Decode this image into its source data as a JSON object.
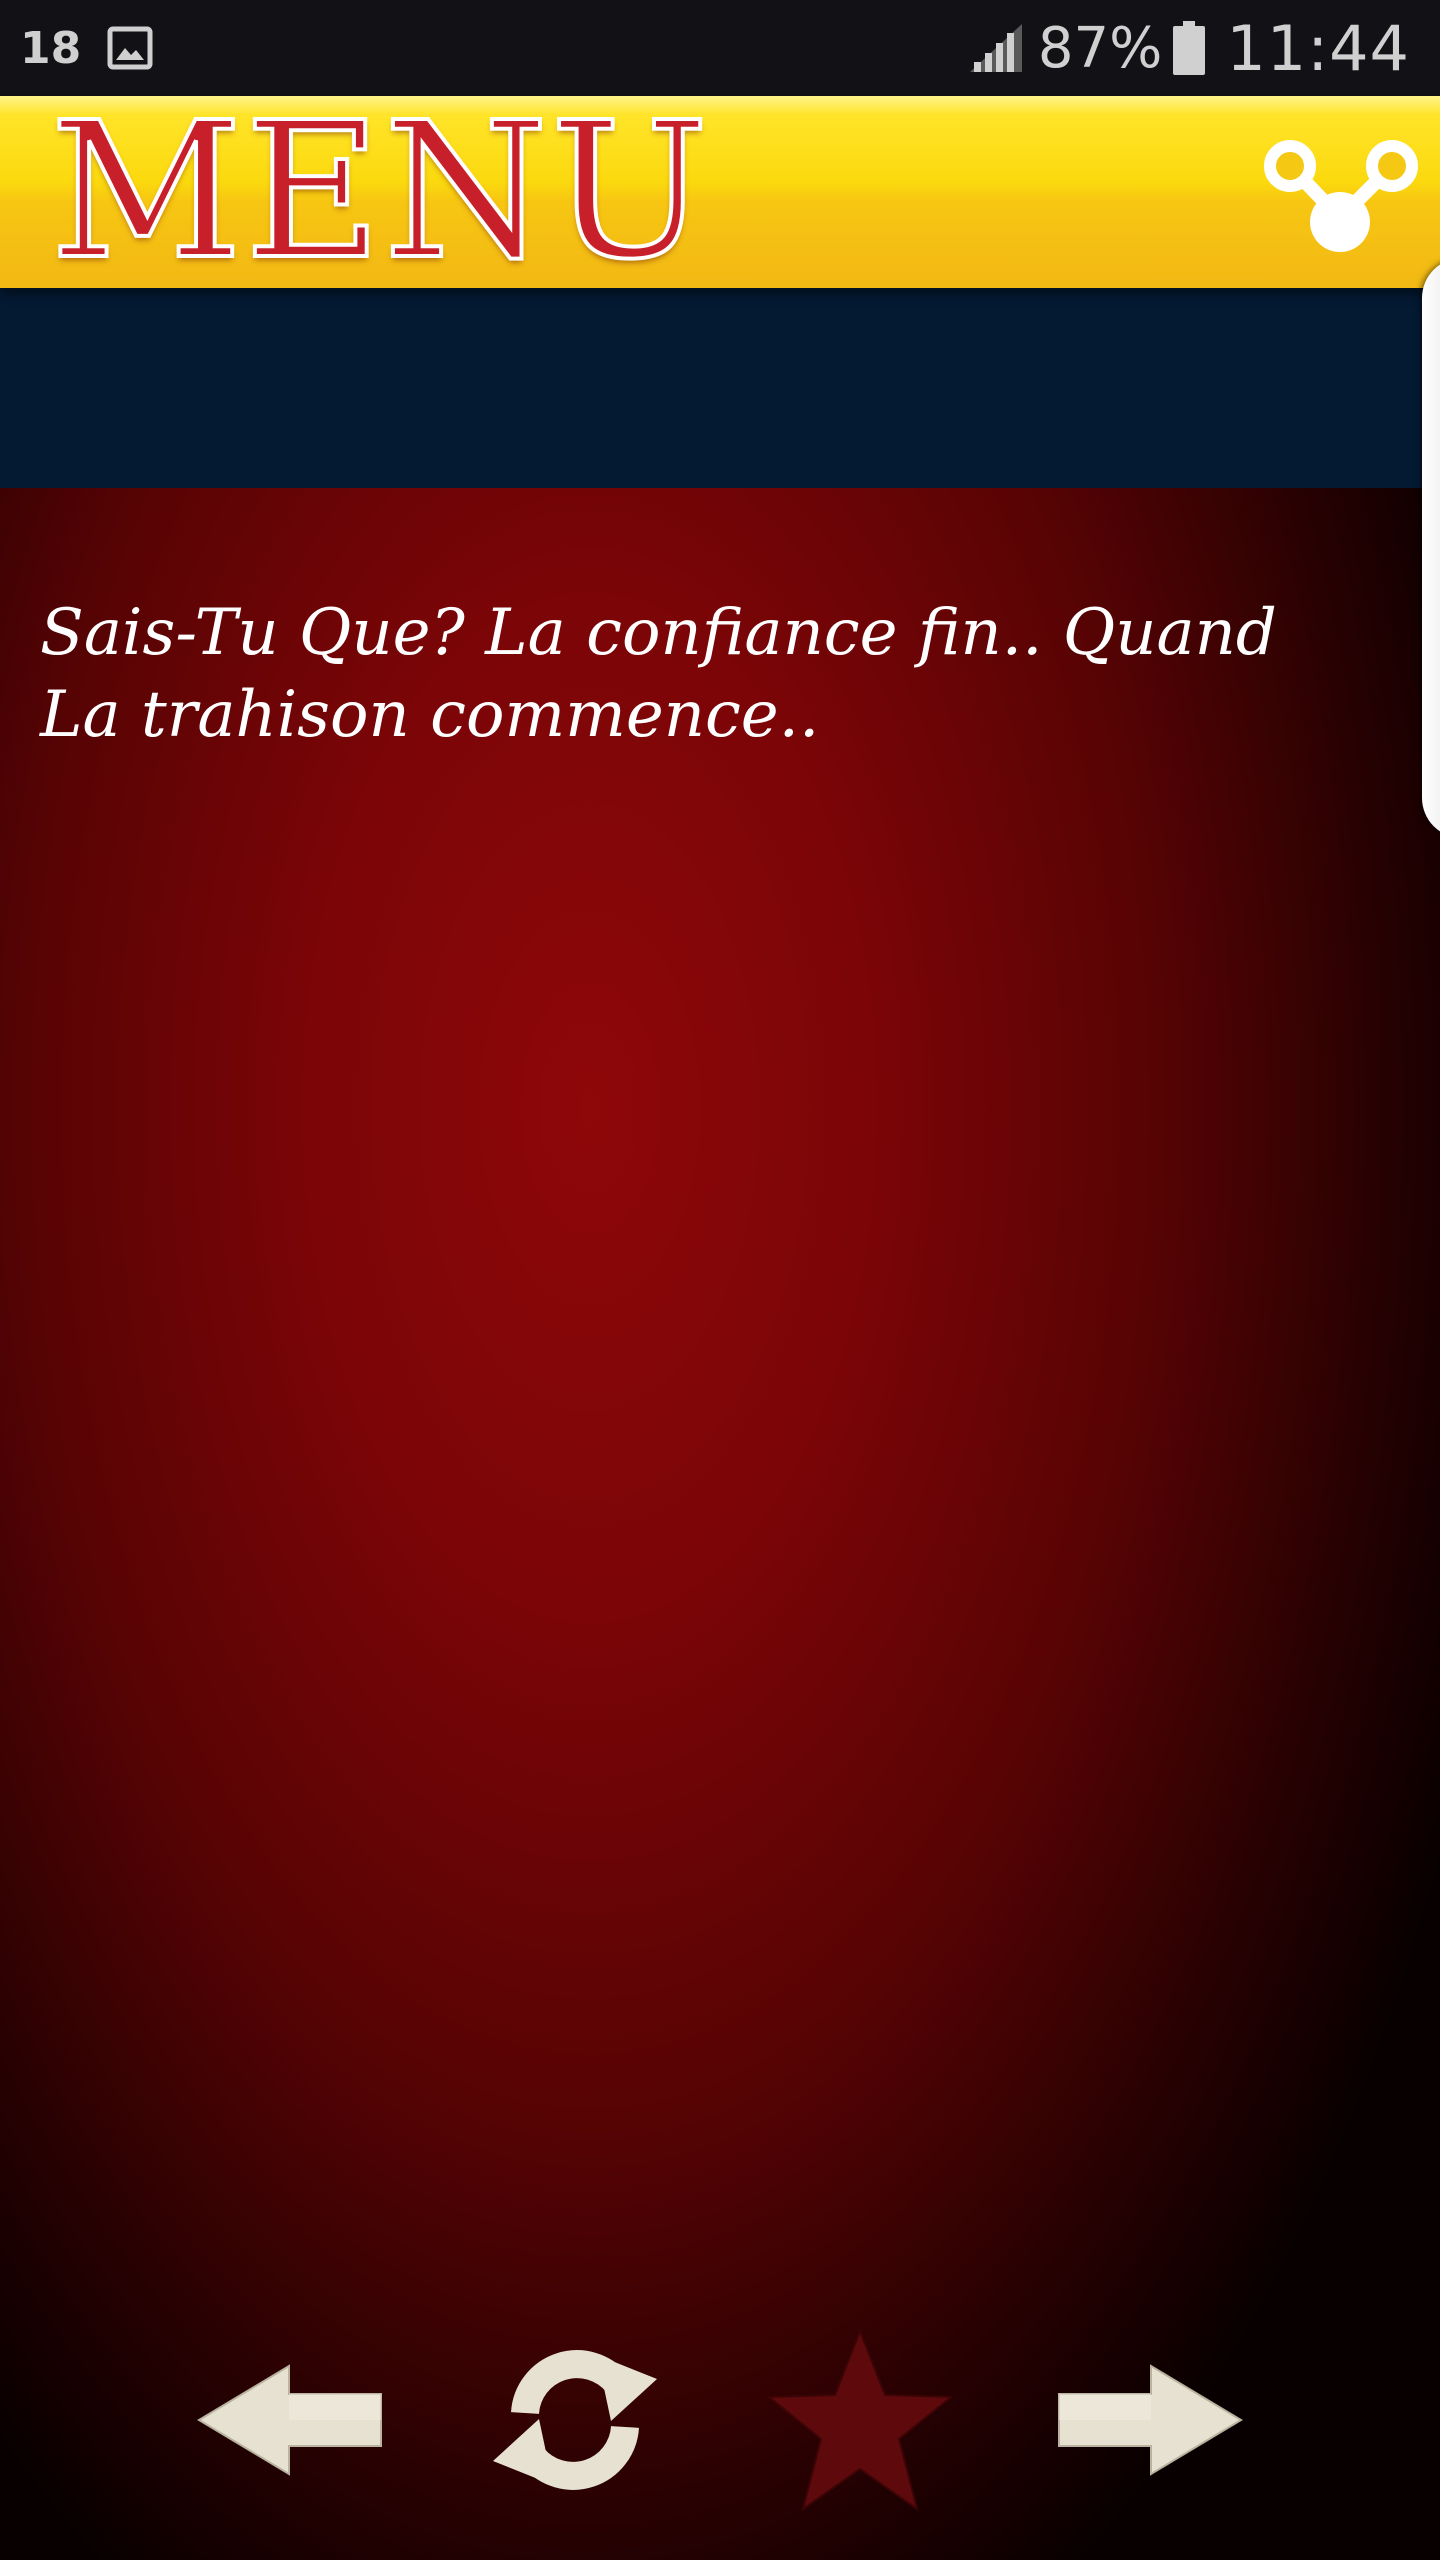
{
  "status_bar": {
    "temperature": "18",
    "battery_percent": "87%",
    "time": "11:44",
    "icons": [
      "gallery-icon",
      "signal-icon",
      "battery-icon"
    ]
  },
  "header": {
    "title": "MENU",
    "share_icon": "share-icon",
    "colors": {
      "bar": "#fbd90e",
      "title": "#c8202a",
      "banner": "#041a33"
    }
  },
  "content": {
    "quote": "Sais-Tu Que? La confiance fin.. Quand La trahison commence.."
  },
  "controls": {
    "prev_icon": "arrow-left-icon",
    "refresh_icon": "refresh-icon",
    "favorite_icon": "star-icon",
    "next_icon": "arrow-right-icon",
    "colors": {
      "button": "#e6e1d0",
      "favorite_inactive": "#5e0a0c"
    }
  }
}
